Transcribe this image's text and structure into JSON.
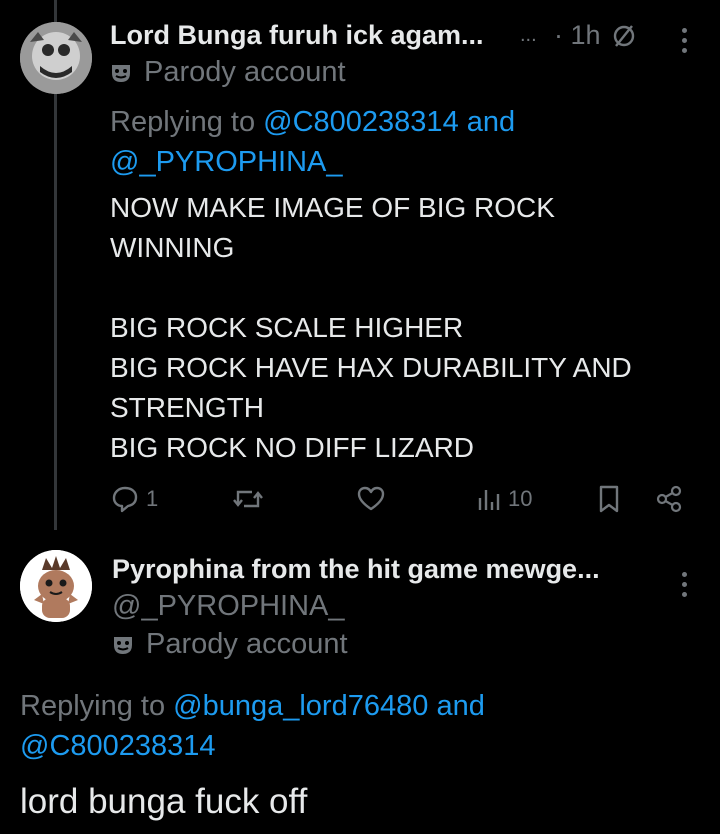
{
  "post1": {
    "author_name": "Lord Bunga furuh ick agam...",
    "ellipsis": "...",
    "time": "· 1h",
    "parody_label": "Parody account",
    "replying_prefix": "Replying to",
    "replying_user1": "@C800238314",
    "replying_and": "and",
    "replying_user2": "@_PYROPHINA_",
    "body_lines": [
      "NOW MAKE IMAGE OF BIG ROCK",
      "WINNING",
      "",
      "BIG ROCK SCALE HIGHER",
      "BIG ROCK HAVE HAX DURABILITY AND",
      "STRENGTH",
      "BIG ROCK NO DIFF LIZARD"
    ],
    "reply_count": "1",
    "views_count": "10"
  },
  "post2": {
    "author_name": "Pyrophina from the hit game mewge...",
    "handle": "@_PYROPHINA_",
    "parody_label": "Parody account",
    "replying_prefix": "Replying to",
    "replying_user1": "@bunga_lord76480",
    "replying_and": "and",
    "replying_user2": "@C800238314",
    "body": "lord bunga fuck off"
  },
  "colors": {
    "background": "#000000",
    "text": "#e7e9ea",
    "muted": "#71767b",
    "link": "#1d9bf0"
  }
}
